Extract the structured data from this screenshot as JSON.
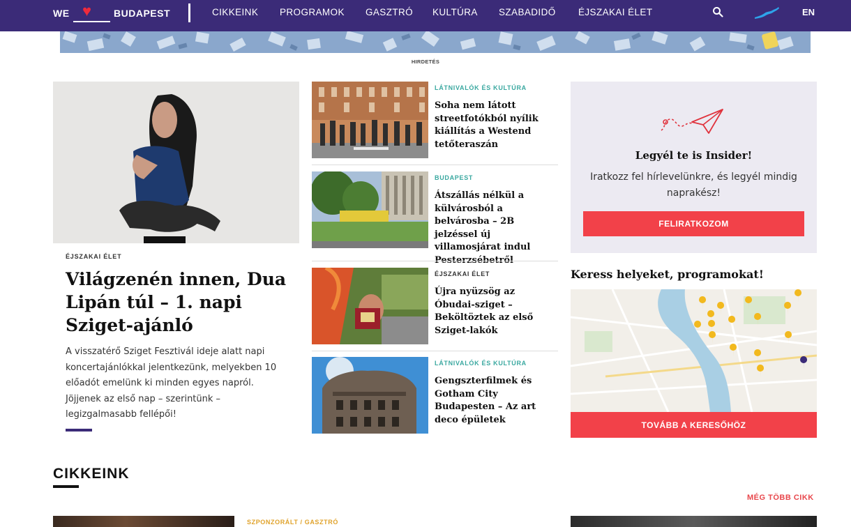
{
  "header": {
    "logo": {
      "word1": "WE",
      "heart": "♥",
      "word2": "BUDAPEST"
    },
    "nav": [
      "CIKKEINK",
      "PROGRAMOK",
      "GASZTRÓ",
      "KULTÚRA",
      "SZABADIDŐ",
      "ÉJSZAKAI ÉLET"
    ],
    "language": "EN",
    "icons": [
      "search-icon",
      "map-mini-icon"
    ]
  },
  "ad": {
    "label": "HIRDETÉS"
  },
  "featured": {
    "category": "ÉJSZAKAI ÉLET",
    "title": "Világzenén innen, Dua Lipán túl – 1. napi Sziget-ajánló",
    "excerpt": "A visszatérő Sziget Fesztivál ideje alatt napi koncertajánlókkal jelentkezünk, melyekben 10 előadót emelünk ki minden egyes napról. Jöjjenek az első nap – szerintünk – legizgalmasabb fellépői!"
  },
  "articles": [
    {
      "category": "LÁTNIVALÓK ÉS KULTÚRA",
      "category_color": "#3aa8a0",
      "title": "Soha nem látott streetfotókból nyílik kiállítás a Westend tetőteraszán"
    },
    {
      "category": "BUDAPEST",
      "category_color": "#3aa8a0",
      "title": "Átszállás nélkül a külvárosból a belvárosba – 2B jelzéssel új villamosjárat indul Pesterzsébetről"
    },
    {
      "category": "ÉJSZAKAI ÉLET",
      "category_color": "#333333",
      "title": "Újra nyüzsög az Óbudai-sziget – Beköltöztek az első Sziget-lakók"
    },
    {
      "category": "LÁTNIVALÓK ÉS KULTÚRA",
      "category_color": "#3aa8a0",
      "title": "Gengszterfilmek és Gotham City Budapesten – Az art deco épületek"
    }
  ],
  "newsletter": {
    "title": "Legyél te is Insider!",
    "text": "Iratkozz fel hírlevelünkre, és legyél mindig naprakész!",
    "button": "FELIRATKOZOM"
  },
  "map_search": {
    "heading": "Keress helyeket, programokat!",
    "button": "TOVÁBB A KERESŐHÖZ"
  },
  "section": {
    "title": "CIKKEINK",
    "more": "MÉG TÖBB CIKK",
    "next_category": "SZPONZORÁLT / GASZTRÓ"
  },
  "colors": {
    "nav_bg": "#3b2b78",
    "accent_red": "#f24149",
    "teal": "#3aa8a0",
    "sponsored": "#e0a22a"
  }
}
